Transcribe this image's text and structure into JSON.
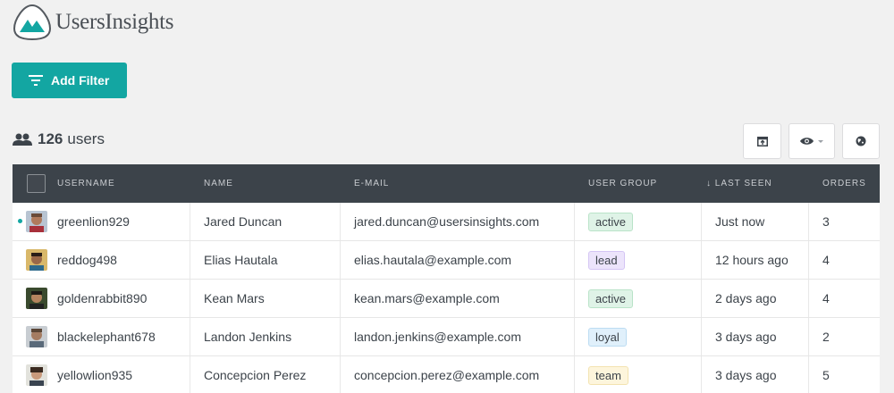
{
  "app": {
    "name": "UsersInsights"
  },
  "toolbar": {
    "add_filter_label": "Add Filter"
  },
  "summary": {
    "count": "126",
    "unit": "users"
  },
  "table": {
    "columns": [
      "USERNAME",
      "NAME",
      "E-MAIL",
      "USER GROUP",
      "↓ LAST SEEN",
      "ORDERS"
    ],
    "rows": [
      {
        "username": "greenlion929",
        "name": "Jared Duncan",
        "email": "jared.duncan@usersinsights.com",
        "group": "active",
        "last_seen": "Just now",
        "orders": "3"
      },
      {
        "username": "reddog498",
        "name": "Elias Hautala",
        "email": "elias.hautala@example.com",
        "group": "lead",
        "last_seen": "12 hours ago",
        "orders": "4"
      },
      {
        "username": "goldenrabbit890",
        "name": "Kean Mars",
        "email": "kean.mars@example.com",
        "group": "active",
        "last_seen": "2 days ago",
        "orders": "4"
      },
      {
        "username": "blackelephant678",
        "name": "Landon Jenkins",
        "email": "landon.jenkins@example.com",
        "group": "loyal",
        "last_seen": "3 days ago",
        "orders": "2"
      },
      {
        "username": "yellowlion935",
        "name": "Concepcion Perez",
        "email": "concepcion.perez@example.com",
        "group": "team",
        "last_seen": "3 days ago",
        "orders": "5"
      }
    ]
  },
  "colors": {
    "accent": "#13a6a2",
    "header_bg": "#3c434a"
  }
}
